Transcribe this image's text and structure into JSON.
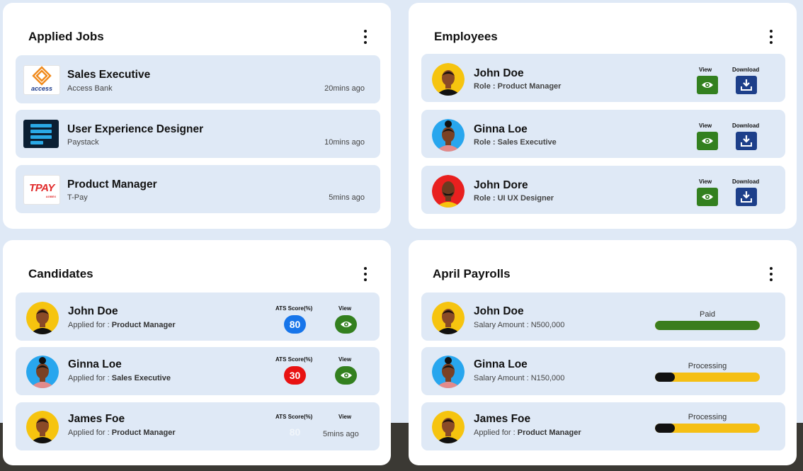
{
  "applied_jobs": {
    "title": "Applied Jobs",
    "items": [
      {
        "title": "Sales Executive",
        "company": "Access Bank",
        "time": "20mins ago",
        "logo_text": "access"
      },
      {
        "title": "User Experience Designer",
        "company": "Paystack",
        "time": "10mins ago"
      },
      {
        "title": "Product Manager",
        "company": "T-Pay",
        "time": "5mins ago",
        "logo_text": "TPAY",
        "logo_subtext": "AGBEX"
      }
    ]
  },
  "employees": {
    "title": "Employees",
    "view_label": "View",
    "download_label": "Download",
    "items": [
      {
        "name": "John Doe",
        "role": "Role : Product Manager",
        "avatar_bg": "#f6c40f"
      },
      {
        "name": "Ginna Loe",
        "role": "Role : Sales Executive",
        "avatar_bg": "#28a6ee"
      },
      {
        "name": "John Dore",
        "role": "Role : UI UX Designer",
        "avatar_bg": "#e8201f"
      }
    ]
  },
  "candidates": {
    "title": "Candidates",
    "ats_label": "ATS Score(%)",
    "view_label": "View",
    "items": [
      {
        "name": "John Doe",
        "applied_prefix": "Applied for : ",
        "applied_role": "Product Manager",
        "score": "80",
        "score_color": "#1775ea"
      },
      {
        "name": "Ginna Loe",
        "applied_prefix": "Applied for : ",
        "applied_role": "Sales Executive",
        "score": "30",
        "score_color": "#e81212"
      },
      {
        "name": "James Foe",
        "applied_prefix": "Applied for : ",
        "applied_role": "Product Manager",
        "score": "80",
        "overlay_time": "5mins ago"
      }
    ]
  },
  "payrolls": {
    "title": "April Payrolls",
    "items": [
      {
        "name": "John Doe",
        "detail": "Salary Amount :  N500,000",
        "status": "Paid",
        "progress": 1.0,
        "fill_color": "#3b7d1d"
      },
      {
        "name": "Ginna Loe",
        "detail": "Salary Amount : N150,000",
        "status": "Processing",
        "progress": 0.19,
        "fill_color": "#111111"
      },
      {
        "name": "James Foe",
        "detail_prefix": "Applied for : ",
        "detail_role": "Product Manager",
        "status": "Processing",
        "progress": 0.19,
        "fill_color": "#111111"
      }
    ]
  },
  "colors": {
    "page_bg": "#dfe9f6",
    "row_bg": "#dfe9f6",
    "green": "#33801f",
    "navy": "#1d3f8a",
    "yellow": "#f5bf14"
  }
}
